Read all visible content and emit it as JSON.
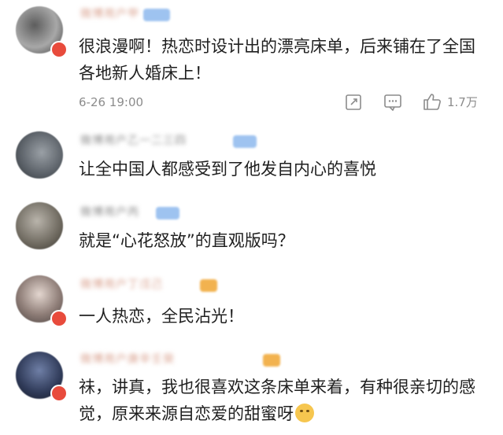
{
  "comments": [
    {
      "username": "微博用户甲",
      "text": "很浪漫啊！热恋时设计出的漂亮床单，后来铺在了全国各地新人婚床上！",
      "time": "6-26 19:00",
      "likes": "1.7万"
    },
    {
      "username": "微博用户乙一二三四",
      "text": "让全中国人都感受到了他发自内心的喜悦"
    },
    {
      "username": "微博用户丙",
      "text": "就是“心花怒放”的直观版吗？"
    },
    {
      "username": "微博用户丁戊己",
      "text": "一人热恋，全民沾光！"
    },
    {
      "username": "微博用户庚辛壬癸",
      "text": "祙，讲真，我也很喜欢这条床单来着，有种很亲切的感觉，原来来源自恋爱的甜蜜呀"
    }
  ],
  "icons": {
    "share": "share-icon",
    "comment": "comment-icon",
    "like": "like-icon",
    "emoji": "thinking-face-emoji"
  }
}
